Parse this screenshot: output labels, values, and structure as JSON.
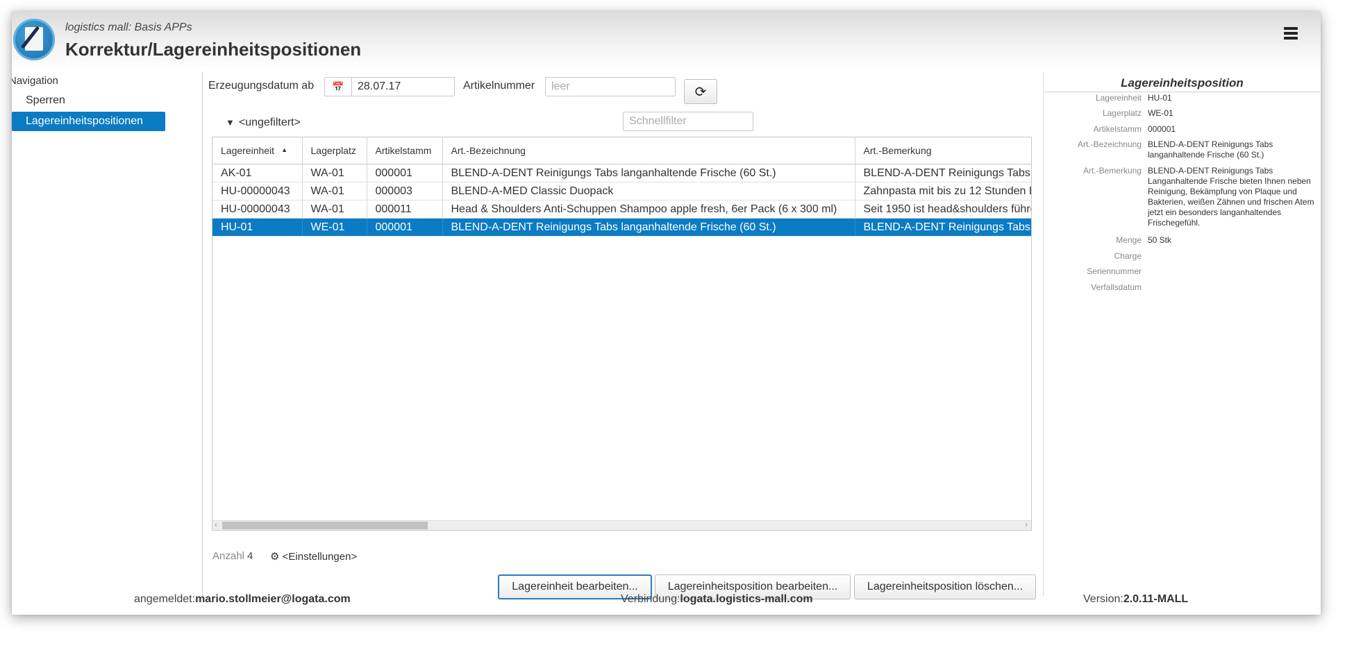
{
  "header": {
    "subtitle": "logistics mall: Basis APPs",
    "title": "Korrektur/Lagereinheitspositionen"
  },
  "navigation": {
    "title": "Navigation",
    "items": [
      {
        "label": "Sperren",
        "active": false
      },
      {
        "label": "Lagereinheitspositionen",
        "active": true
      }
    ]
  },
  "filter": {
    "date_label": "Erzeugungsdatum ab",
    "date_value": "28.07.17",
    "article_label": "Artikelnummer",
    "article_placeholder": "leer",
    "filter_state": "<ungefiltert>",
    "quick_filter_placeholder": "Schnellfilter"
  },
  "table": {
    "columns": [
      "Lagereinheit",
      "Lagerplatz",
      "Artikelstamm",
      "Art.-Bezeichnung",
      "Art.-Bemerkung"
    ],
    "rows": [
      [
        "AK-01",
        "WA-01",
        "000001",
        "BLEND-A-DENT Reinigungs Tabs langanhaltende Frische (60 St.)",
        "BLEND-A-DENT Reinigungs Tabs"
      ],
      [
        "HU-00000043",
        "WA-01",
        "000003",
        "BLEND-A-MED Classic Duopack",
        "Zahnpasta mit bis zu 12 Stunden L"
      ],
      [
        "HU-00000043",
        "WA-01",
        "000011",
        "Head & Shoulders Anti-Schuppen Shampoo apple fresh, 6er Pack (6 x 300 ml)",
        "Seit 1950 ist head&shoulders führe"
      ],
      [
        "HU-01",
        "WE-01",
        "000001",
        "BLEND-A-DENT Reinigungs Tabs langanhaltende Frische (60 St.)",
        "BLEND-A-DENT Reinigungs Tabs"
      ]
    ],
    "selected_row": 3
  },
  "summary": {
    "count_label": "Anzahl",
    "count_value": "4",
    "settings_label": "<Einstellungen>"
  },
  "actions": {
    "edit_unit": "Lagereinheit bearbeiten...",
    "edit_position": "Lagereinheitsposition bearbeiten...",
    "delete_position": "Lagereinheitsposition löschen..."
  },
  "detail": {
    "title": "Lagereinheitsposition",
    "fields": [
      {
        "label": "Lagereinheit",
        "value": "HU-01"
      },
      {
        "label": "Lagerplatz",
        "value": "WE-01"
      },
      {
        "label": "Artikelstamm",
        "value": "000001"
      },
      {
        "label": "Art.-Bezeichnung",
        "value": "BLEND-A-DENT Reinigungs Tabs langanhaltende Frische (60 St.)"
      },
      {
        "label": "Art.-Bemerkung",
        "value": "BLEND-A-DENT Reinigungs Tabs Langanhaltende Frische bieten Ihnen neben Reinigung, Bekämpfung von Plaque und Bakterien, weißen Zähnen und frischen Atem jetzt ein besonders langanhaltendes Frischegefühl."
      },
      {
        "label": "Menge",
        "value": "50 Stk"
      },
      {
        "label": "Charge",
        "value": ""
      },
      {
        "label": "Seriennummer",
        "value": ""
      },
      {
        "label": "Verfallsdatum",
        "value": ""
      }
    ]
  },
  "footer": {
    "user_label": "angemeldet:",
    "user_value": "mario.stollmeier@logata.com",
    "connection_label": "Verbindung:",
    "connection_value": "logata.logistics-mall.com",
    "version_label": "Version:",
    "version_value": "2.0.11-MALL"
  },
  "colors": {
    "accent": "#0b7bc4"
  }
}
